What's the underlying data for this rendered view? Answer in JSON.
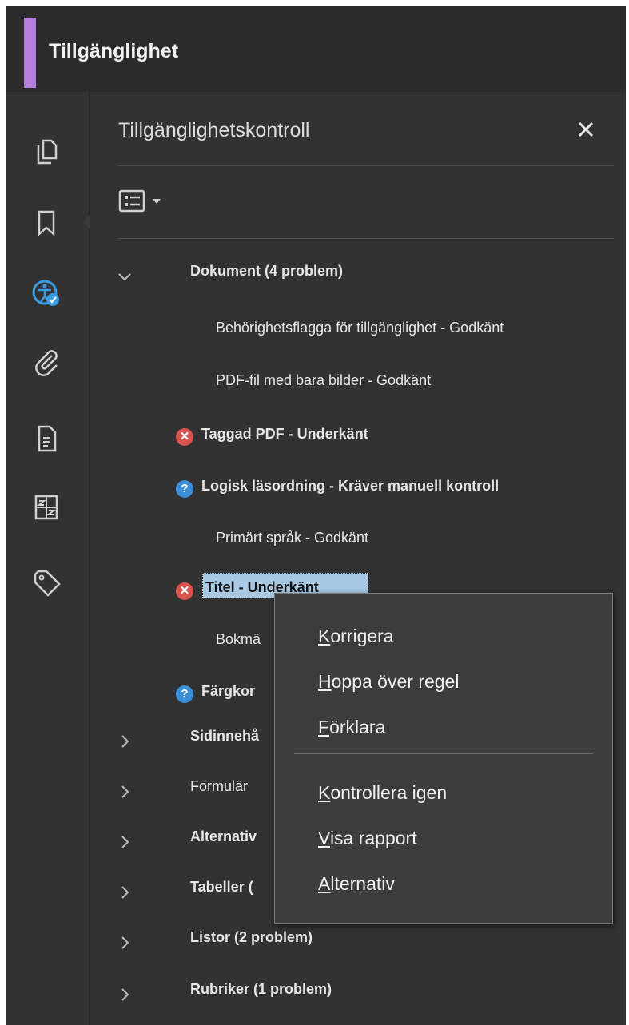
{
  "app": {
    "title": "Tillgänglighet",
    "accent_color": "#b57edc"
  },
  "leftbar": {
    "icons": [
      "pages-icon",
      "bookmark-icon",
      "accessibility-icon",
      "attachment-icon",
      "document-icon",
      "layers-icon",
      "tag-icon"
    ],
    "active": "accessibility-icon"
  },
  "panel": {
    "title": "Tillgänglighetskontroll",
    "close_icon": "close-icon",
    "options_icon": "options-list-icon"
  },
  "tree": {
    "document": {
      "label": "Dokument (4 problem)",
      "expanded": true,
      "items": [
        {
          "status": "pass",
          "label": "Behörighetsflagga för tillgänglighet - Godkänt"
        },
        {
          "status": "pass",
          "label": "PDF-fil med bara bilder - Godkänt"
        },
        {
          "status": "fail",
          "label": "Taggad PDF - Underkänt"
        },
        {
          "status": "manual",
          "label": "Logisk läsordning - Kräver manuell kontroll"
        },
        {
          "status": "pass",
          "label": "Primärt språk - Godkänt"
        },
        {
          "status": "fail",
          "label": "Titel - Underkänt",
          "selected": true
        },
        {
          "status": "pass",
          "label": "Bokmä"
        },
        {
          "status": "manual",
          "label": "Färgkor"
        }
      ]
    },
    "categories": [
      {
        "label": "Sidinnehå",
        "bold": true
      },
      {
        "label": "Formulär",
        "bold": false
      },
      {
        "label": "Alternativ",
        "bold": true
      },
      {
        "label": "Tabeller (",
        "bold": true
      },
      {
        "label": "Listor (2 problem)",
        "bold": true
      },
      {
        "label": "Rubriker (1 problem)",
        "bold": true
      }
    ],
    "status_colors": {
      "fail": "#d9534f",
      "manual": "#3a8fd8"
    },
    "status_glyphs": {
      "fail": "✕",
      "manual": "?"
    }
  },
  "context_menu": {
    "items": [
      {
        "accel": "K",
        "rest": "orrigera"
      },
      {
        "accel": "H",
        "rest": "oppa över regel"
      },
      {
        "accel": "F",
        "rest": "örklara"
      },
      {
        "accel": "K",
        "rest": "ontrollera igen"
      },
      {
        "accel": "V",
        "rest": "isa rapport"
      },
      {
        "accel": "A",
        "rest": "lternativ"
      }
    ]
  }
}
